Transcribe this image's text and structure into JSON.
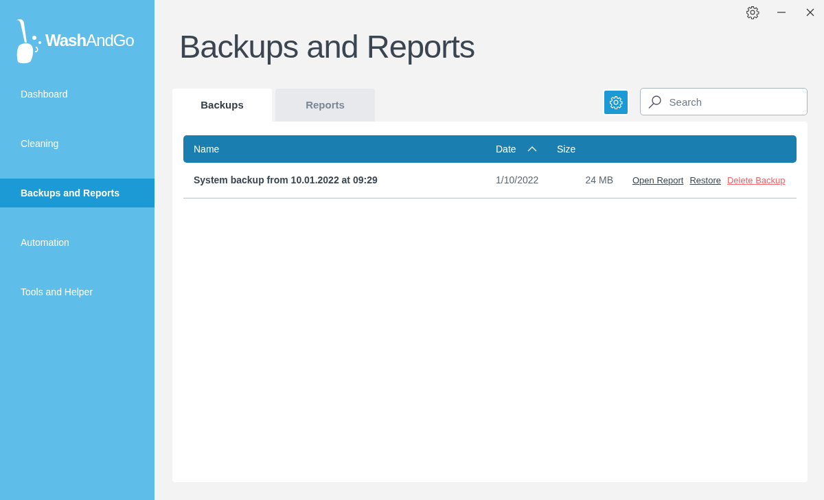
{
  "app": {
    "logo": "**Wash**AndGo"
  },
  "sidebar": {
    "items": [
      {
        "label": "Dashboard",
        "selected": false
      },
      {
        "label": "Cleaning",
        "selected": false
      },
      {
        "label": "Backups and Reports",
        "selected": true
      },
      {
        "label": "Automation",
        "selected": false
      },
      {
        "label": "Tools and Helper",
        "selected": false
      }
    ]
  },
  "page": {
    "title": "Backups and Reports"
  },
  "tabs": [
    {
      "label": "Backups",
      "selected": true
    },
    {
      "label": "Reports",
      "selected": false
    }
  ],
  "search": {
    "placeholder": "Search"
  },
  "table": {
    "columns": [
      {
        "label": "Name",
        "sorted": false
      },
      {
        "label": "Date",
        "sorted": true
      },
      {
        "label": "Size",
        "sorted": false
      }
    ],
    "rows": [
      {
        "name": "System backup from 10.01.2022 at 09:29",
        "date": "1/10/2022",
        "size": "24 MB",
        "actions": [
          {
            "label": "Open Report",
            "kind": "normal"
          },
          {
            "label": "Restore",
            "kind": "normal"
          },
          {
            "label": "Delete Backup",
            "kind": "danger"
          }
        ]
      }
    ]
  }
}
